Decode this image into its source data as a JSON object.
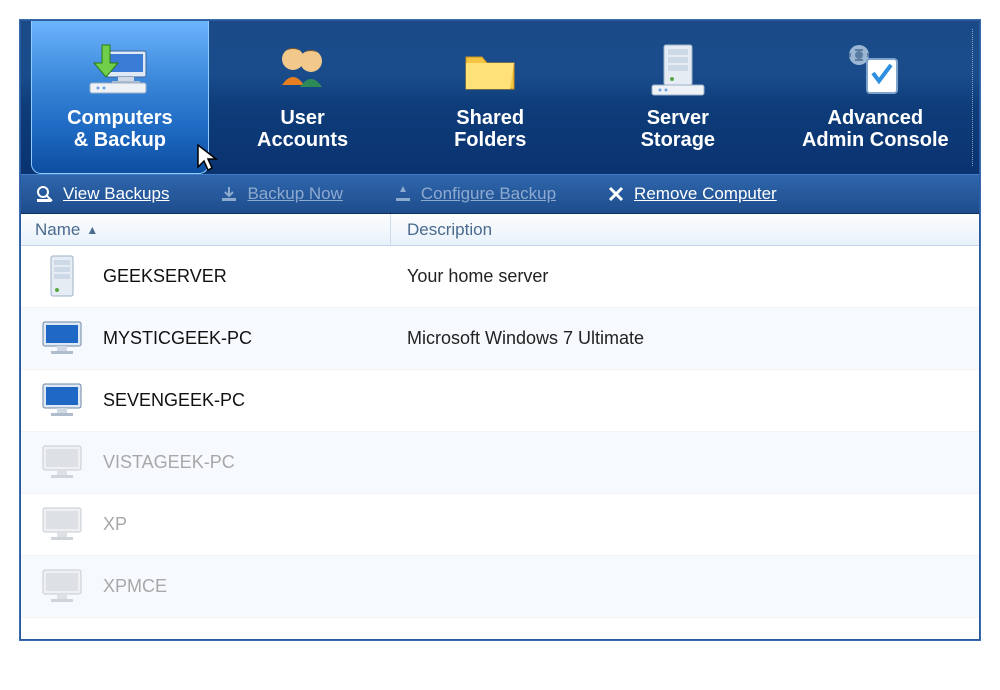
{
  "nav": {
    "tabs": [
      {
        "id": "computers",
        "line1": "Computers",
        "line2": "& Backup",
        "active": true
      },
      {
        "id": "users",
        "line1": "User",
        "line2": "Accounts",
        "active": false
      },
      {
        "id": "shared",
        "line1": "Shared",
        "line2": "Folders",
        "active": false
      },
      {
        "id": "storage",
        "line1": "Server",
        "line2": "Storage",
        "active": false
      },
      {
        "id": "advanced",
        "line1": "Advanced",
        "line2": "Admin Console",
        "active": false
      }
    ]
  },
  "toolbar": {
    "view_backups": "View Backups",
    "backup_now": "Backup Now",
    "configure_backup": "Configure Backup",
    "remove_computer": "Remove Computer"
  },
  "columns": {
    "name": "Name",
    "description": "Description"
  },
  "rows": [
    {
      "name": "GEEKSERVER",
      "description": "Your home server",
      "icon": "server",
      "dim": false
    },
    {
      "name": "MYSTICGEEK-PC",
      "description": "Microsoft Windows 7 Ultimate",
      "icon": "monitor",
      "dim": false
    },
    {
      "name": "SEVENGEEK-PC",
      "description": "",
      "icon": "monitor",
      "dim": false
    },
    {
      "name": "VISTAGEEK-PC",
      "description": "",
      "icon": "monitor-off",
      "dim": true
    },
    {
      "name": "XP",
      "description": "",
      "icon": "monitor-off",
      "dim": true
    },
    {
      "name": "XPMCE",
      "description": "",
      "icon": "monitor-off",
      "dim": true
    }
  ]
}
